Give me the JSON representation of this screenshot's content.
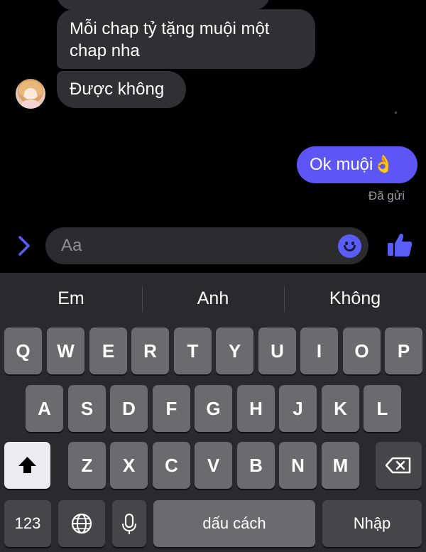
{
  "messages": [
    {
      "from": "other",
      "text": "Mỗi chap tỷ tặng muội một chap nha"
    },
    {
      "from": "other",
      "text": "Được không"
    },
    {
      "from": "me",
      "text": "Ok muội",
      "emoji": "👌"
    }
  ],
  "status_text": "Đã gửi",
  "composer": {
    "placeholder": "Aa",
    "expand_icon": "chevron-right-icon",
    "emoji_icon": "smiley-icon",
    "like_icon": "thumbs-up-icon"
  },
  "keyboard": {
    "suggestions": [
      "Em",
      "Anh",
      "Không"
    ],
    "row1": [
      "Q",
      "W",
      "E",
      "R",
      "T",
      "Y",
      "U",
      "I",
      "O",
      "P"
    ],
    "row2": [
      "A",
      "S",
      "D",
      "F",
      "G",
      "H",
      "J",
      "K",
      "L"
    ],
    "row3": [
      "Z",
      "X",
      "C",
      "V",
      "B",
      "N",
      "M"
    ],
    "numbers_label": "123",
    "space_label": "dấu cách",
    "return_label": "Nhập"
  },
  "colors": {
    "accent": "#5d55f5",
    "incoming_bubble": "#303033",
    "keyboard_bg": "#2a2a2c"
  }
}
